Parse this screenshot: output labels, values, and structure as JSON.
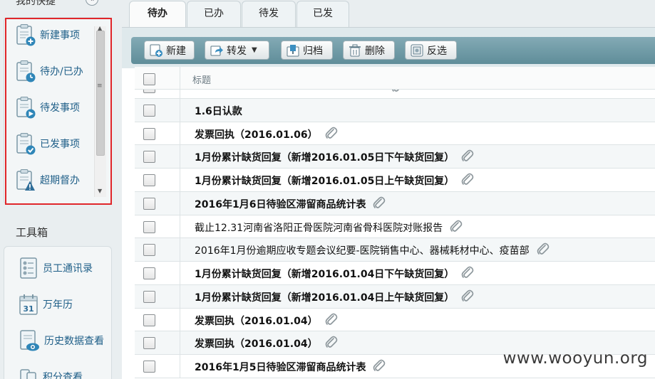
{
  "sidebar": {
    "top_title": "我的快捷",
    "quick_items": [
      {
        "label": "新建事项",
        "icon": "clipboard-plus-icon"
      },
      {
        "label": "待办/已办",
        "icon": "clipboard-clock-icon"
      },
      {
        "label": "待发事项",
        "icon": "clipboard-send-icon"
      },
      {
        "label": "已发事项",
        "icon": "clipboard-check-icon"
      },
      {
        "label": "超期督办",
        "icon": "clipboard-warning-icon"
      }
    ],
    "toolbox_title": "工具箱",
    "tool_items": [
      {
        "label": "员工通讯录",
        "icon": "contacts-icon"
      },
      {
        "label": "万年历",
        "icon": "calendar-icon",
        "day": "31"
      },
      {
        "label": "历史数据查看",
        "icon": "history-view-icon"
      },
      {
        "label": "积分查看",
        "icon": "points-icon"
      }
    ]
  },
  "tabs": [
    {
      "label": "待办",
      "active": true
    },
    {
      "label": "已办",
      "active": false
    },
    {
      "label": "待发",
      "active": false
    },
    {
      "label": "已发",
      "active": false
    }
  ],
  "toolbar": {
    "new_label": "新建",
    "forward_label": "转发",
    "archive_label": "归档",
    "delete_label": "删除",
    "invert_label": "反选"
  },
  "table": {
    "header_title": "标题",
    "rows": [
      {
        "title": "1.6日认款",
        "bold": true,
        "attachment": false
      },
      {
        "title": "发票回执（2016.01.06）",
        "bold": true,
        "attachment": true
      },
      {
        "title": "1月份累计缺货回复（新增2016.01.05日下午缺货回复）",
        "bold": true,
        "attachment": true
      },
      {
        "title": "1月份累计缺货回复（新增2016.01.05日上午缺货回复）",
        "bold": true,
        "attachment": true
      },
      {
        "title": "2016年1月6日待验区滞留商品统计表",
        "bold": true,
        "attachment": true
      },
      {
        "title": "截止12.31河南省洛阳正骨医院河南省骨科医院对账报告",
        "bold": false,
        "attachment": true
      },
      {
        "title": "2016年1月份逾期应收专题会议纪要-医院销售中心、器械耗材中心、疫苗部",
        "bold": false,
        "attachment": true
      },
      {
        "title": "1月份累计缺货回复（新增2016.01.04日下午缺货回复）",
        "bold": true,
        "attachment": true
      },
      {
        "title": "1月份累计缺货回复（新增2016.01.04日上午缺货回复）",
        "bold": true,
        "attachment": true
      },
      {
        "title": "发票回执（2016.01.04）",
        "bold": true,
        "attachment": true
      },
      {
        "title": "发票回执（2016.01.04）",
        "bold": true,
        "attachment": true
      },
      {
        "title": "2016年1月5日待验区滞留商品统计表",
        "bold": true,
        "attachment": true
      }
    ]
  },
  "watermark": "www.wooyun.org",
  "colors": {
    "toolbar_bg": "#6f9aa6",
    "link_text": "#1f5f88",
    "highlight_border": "#e0262a"
  }
}
